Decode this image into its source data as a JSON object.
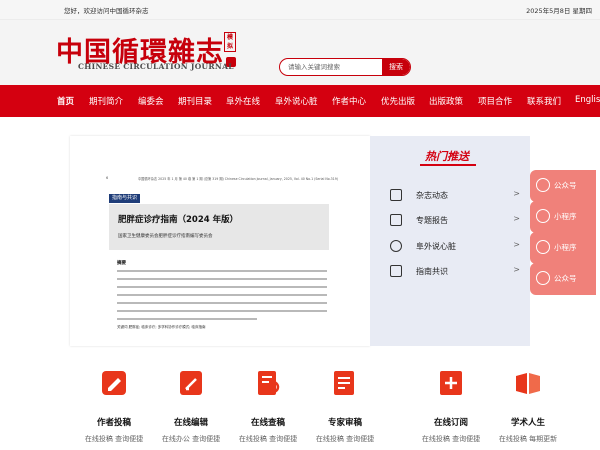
{
  "topbar": {
    "welcome": "您好，欢迎访问中国循环杂志",
    "date": "2025年5月8日 星期四"
  },
  "header": {
    "logo_cn": "中国循環雜志",
    "logo_mark": "模拟",
    "logo_en": "CHINESE CIRCULATION JOURNAL",
    "search_placeholder": "请输入关键词搜索",
    "search_button": "搜索"
  },
  "nav": {
    "items": [
      "首页",
      "期刊简介",
      "编委会",
      "期刊目录",
      "阜外在线",
      "阜外说心脏",
      "作者中心",
      "优先出版",
      "出版政策",
      "项目合作",
      "联系我们",
      "English"
    ]
  },
  "banner": {
    "page_num": "6",
    "running_header": "中国循环杂志 2025 年 1 月 第 40 卷 第 1 期 (总第 319 期) Chinese Circulation Journal, January, 2025, Vol. 40 No.1 (Serial No.319)",
    "tag": "指南与共识",
    "title": "肥胖症诊疗指南（2024 年版）",
    "author": "国家卫生健康委员会肥胖症诊疗指南编写委员会",
    "abstract_label": "摘要",
    "keywords": "关键词 肥胖症; 临床诊疗; 多学科协作诊疗模式; 临床指南"
  },
  "hot": {
    "title": "热门推送",
    "items": [
      {
        "label": "杂志动态",
        "icon": "news-icon",
        "arrow": ">"
      },
      {
        "label": "专题报告",
        "icon": "report-icon",
        "arrow": ">"
      },
      {
        "label": "阜外说心脏",
        "icon": "heart-icon",
        "arrow": ">"
      },
      {
        "label": "指南共识",
        "icon": "guide-icon",
        "arrow": ">"
      }
    ]
  },
  "floats": [
    {
      "label": "公众号",
      "icon": "wechat-icon"
    },
    {
      "label": "小程序",
      "icon": "mini-program-icon"
    },
    {
      "label": "小程序",
      "icon": "mini-program-icon"
    },
    {
      "label": "公众号",
      "icon": "wechat-icon"
    }
  ],
  "services": [
    {
      "title": "作者投稿",
      "sub": "在线投稿 查询便捷",
      "icon": "submit-icon"
    },
    {
      "title": "在线编辑",
      "sub": "在线办公 查询便捷",
      "icon": "edit-icon"
    },
    {
      "title": "在线查稿",
      "sub": "在线投稿 查询便捷",
      "icon": "query-icon"
    },
    {
      "title": "专家审稿",
      "sub": "在线投稿 查询便捷",
      "icon": "review-icon"
    },
    {
      "title": "在线订阅",
      "sub": "在线投稿 查询便捷",
      "icon": "subscribe-icon"
    },
    {
      "title": "学术人生",
      "sub": "在线投稿 每期更新",
      "icon": "academic-icon"
    }
  ],
  "colors": {
    "brand_red": "#d40010",
    "float_pink": "#f0817a",
    "panel_bg": "#e8ebf4"
  }
}
